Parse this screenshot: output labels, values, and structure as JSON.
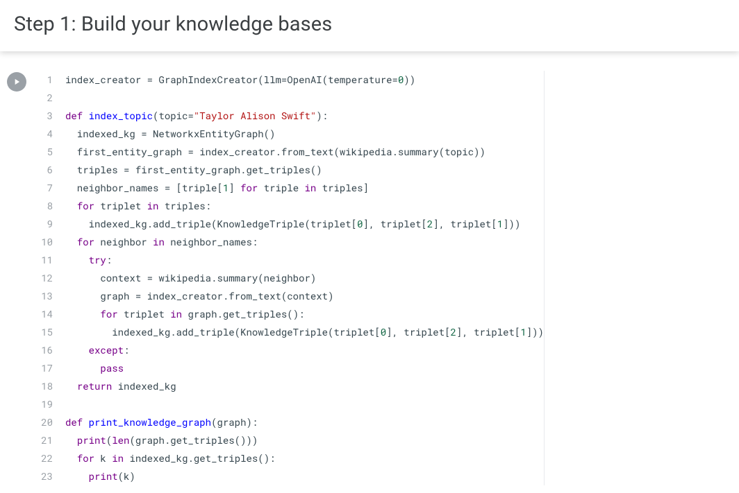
{
  "header": {
    "title": "Step 1: Build your knowledge bases"
  },
  "cell": {
    "run_icon": "play-icon",
    "line_numbers": [
      "1",
      "2",
      "3",
      "4",
      "5",
      "6",
      "7",
      "8",
      "9",
      "10",
      "11",
      "12",
      "13",
      "14",
      "15",
      "16",
      "17",
      "18",
      "19",
      "20",
      "21",
      "22",
      "23"
    ],
    "code_lines": [
      [
        {
          "t": "index_creator ",
          "c": ""
        },
        {
          "t": "=",
          "c": "op"
        },
        {
          "t": " GraphIndexCreator",
          "c": ""
        },
        {
          "t": "(",
          "c": ""
        },
        {
          "t": "llm",
          "c": ""
        },
        {
          "t": "=",
          "c": "op"
        },
        {
          "t": "OpenAI",
          "c": ""
        },
        {
          "t": "(",
          "c": ""
        },
        {
          "t": "temperature",
          "c": ""
        },
        {
          "t": "=",
          "c": "op"
        },
        {
          "t": "0",
          "c": "num"
        },
        {
          "t": "))",
          "c": ""
        }
      ],
      [],
      [
        {
          "t": "def",
          "c": "kw"
        },
        {
          "t": " ",
          "c": ""
        },
        {
          "t": "index_topic",
          "c": "fn"
        },
        {
          "t": "(",
          "c": ""
        },
        {
          "t": "topic",
          "c": ""
        },
        {
          "t": "=",
          "c": "op"
        },
        {
          "t": "\"Taylor Alison Swift\"",
          "c": "str"
        },
        {
          "t": "):",
          "c": ""
        }
      ],
      [
        {
          "t": "  indexed_kg ",
          "c": ""
        },
        {
          "t": "=",
          "c": "op"
        },
        {
          "t": " NetworkxEntityGraph()",
          "c": ""
        }
      ],
      [
        {
          "t": "  first_entity_graph ",
          "c": ""
        },
        {
          "t": "=",
          "c": "op"
        },
        {
          "t": " index_creator.from_text(wikipedia.summary(topic))",
          "c": ""
        }
      ],
      [
        {
          "t": "  triples ",
          "c": ""
        },
        {
          "t": "=",
          "c": "op"
        },
        {
          "t": " first_entity_graph.get_triples()",
          "c": ""
        }
      ],
      [
        {
          "t": "  neighbor_names ",
          "c": ""
        },
        {
          "t": "=",
          "c": "op"
        },
        {
          "t": " [triple[",
          "c": ""
        },
        {
          "t": "1",
          "c": "num"
        },
        {
          "t": "] ",
          "c": ""
        },
        {
          "t": "for",
          "c": "kw"
        },
        {
          "t": " triple ",
          "c": ""
        },
        {
          "t": "in",
          "c": "kw"
        },
        {
          "t": " triples]",
          "c": ""
        }
      ],
      [
        {
          "t": "  ",
          "c": ""
        },
        {
          "t": "for",
          "c": "kw"
        },
        {
          "t": " triplet ",
          "c": ""
        },
        {
          "t": "in",
          "c": "kw"
        },
        {
          "t": " triples:",
          "c": ""
        }
      ],
      [
        {
          "t": "    indexed_kg.add_triple(KnowledgeTriple(triplet[",
          "c": ""
        },
        {
          "t": "0",
          "c": "num"
        },
        {
          "t": "], triplet[",
          "c": ""
        },
        {
          "t": "2",
          "c": "num"
        },
        {
          "t": "], triplet[",
          "c": ""
        },
        {
          "t": "1",
          "c": "num"
        },
        {
          "t": "]))",
          "c": ""
        }
      ],
      [
        {
          "t": "  ",
          "c": ""
        },
        {
          "t": "for",
          "c": "kw"
        },
        {
          "t": " neighbor ",
          "c": ""
        },
        {
          "t": "in",
          "c": "kw"
        },
        {
          "t": " neighbor_names:",
          "c": ""
        }
      ],
      [
        {
          "t": "    ",
          "c": ""
        },
        {
          "t": "try",
          "c": "kw"
        },
        {
          "t": ":",
          "c": ""
        }
      ],
      [
        {
          "t": "      context ",
          "c": ""
        },
        {
          "t": "=",
          "c": "op"
        },
        {
          "t": " wikipedia.summary(neighbor)",
          "c": ""
        }
      ],
      [
        {
          "t": "      graph ",
          "c": ""
        },
        {
          "t": "=",
          "c": "op"
        },
        {
          "t": " index_creator.from_text(context)",
          "c": ""
        }
      ],
      [
        {
          "t": "      ",
          "c": ""
        },
        {
          "t": "for",
          "c": "kw"
        },
        {
          "t": " triplet ",
          "c": ""
        },
        {
          "t": "in",
          "c": "kw"
        },
        {
          "t": " graph.get_triples():",
          "c": ""
        }
      ],
      [
        {
          "t": "        indexed_kg.add_triple(KnowledgeTriple(triplet[",
          "c": ""
        },
        {
          "t": "0",
          "c": "num"
        },
        {
          "t": "], triplet[",
          "c": ""
        },
        {
          "t": "2",
          "c": "num"
        },
        {
          "t": "], triplet[",
          "c": ""
        },
        {
          "t": "1",
          "c": "num"
        },
        {
          "t": "]))",
          "c": ""
        }
      ],
      [
        {
          "t": "    ",
          "c": ""
        },
        {
          "t": "except",
          "c": "kw"
        },
        {
          "t": ":",
          "c": ""
        }
      ],
      [
        {
          "t": "      ",
          "c": ""
        },
        {
          "t": "pass",
          "c": "kw"
        }
      ],
      [
        {
          "t": "  ",
          "c": ""
        },
        {
          "t": "return",
          "c": "kw"
        },
        {
          "t": " indexed_kg",
          "c": ""
        }
      ],
      [],
      [
        {
          "t": "def",
          "c": "kw"
        },
        {
          "t": " ",
          "c": ""
        },
        {
          "t": "print_knowledge_graph",
          "c": "fn"
        },
        {
          "t": "(graph):",
          "c": ""
        }
      ],
      [
        {
          "t": "  ",
          "c": ""
        },
        {
          "t": "print",
          "c": "bi"
        },
        {
          "t": "(",
          "c": ""
        },
        {
          "t": "len",
          "c": "bi"
        },
        {
          "t": "(graph.get_triples()))",
          "c": ""
        }
      ],
      [
        {
          "t": "  ",
          "c": ""
        },
        {
          "t": "for",
          "c": "kw"
        },
        {
          "t": " k ",
          "c": ""
        },
        {
          "t": "in",
          "c": "kw"
        },
        {
          "t": " indexed_kg.get_triples():",
          "c": ""
        }
      ],
      [
        {
          "t": "    ",
          "c": ""
        },
        {
          "t": "print",
          "c": "bi"
        },
        {
          "t": "(k)",
          "c": ""
        }
      ]
    ]
  }
}
